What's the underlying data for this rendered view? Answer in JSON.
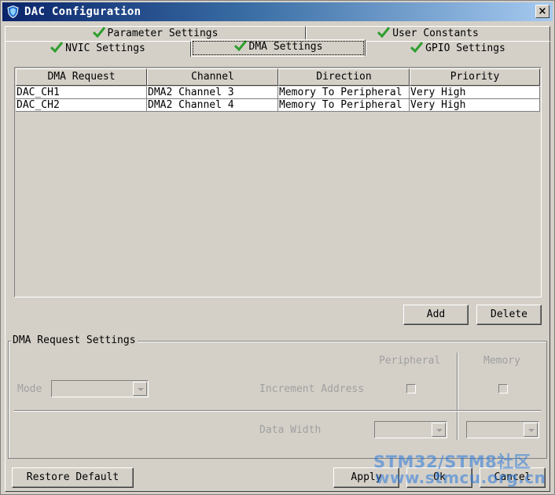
{
  "window": {
    "title": "DAC Configuration",
    "close_label": "×"
  },
  "tabs": {
    "row1": [
      {
        "label": "Parameter Settings"
      },
      {
        "label": "User Constants"
      }
    ],
    "row2": [
      {
        "label": "NVIC Settings"
      },
      {
        "label": "DMA Settings",
        "active": true
      },
      {
        "label": "GPIO Settings"
      }
    ]
  },
  "table": {
    "headers": [
      "DMA Request",
      "Channel",
      "Direction",
      "Priority"
    ],
    "rows": [
      [
        "DAC_CH1",
        "DMA2 Channel 3",
        "Memory To Peripheral",
        "Very High"
      ],
      [
        "DAC_CH2",
        "DMA2 Channel 4",
        "Memory To Peripheral",
        "Very High"
      ]
    ]
  },
  "buttons": {
    "add": "Add",
    "delete": "Delete",
    "restore": "Restore Default",
    "apply": "Apply",
    "ok": "Ok",
    "cancel": "Cancel"
  },
  "dma_settings": {
    "title": "DMA Request Settings",
    "peripheral_label": "Peripheral",
    "memory_label": "Memory",
    "mode_label": "Mode",
    "increment_label": "Increment Address",
    "data_width_label": "Data Width"
  },
  "watermark": {
    "line1": "STM32/STM8社区",
    "line2": "www.stmcu.org.cn"
  },
  "colors": {
    "titlebar_start": "#0a246a",
    "titlebar_end": "#a6caf0",
    "check_green": "#2e9e2e",
    "face": "#d4d0c8"
  }
}
